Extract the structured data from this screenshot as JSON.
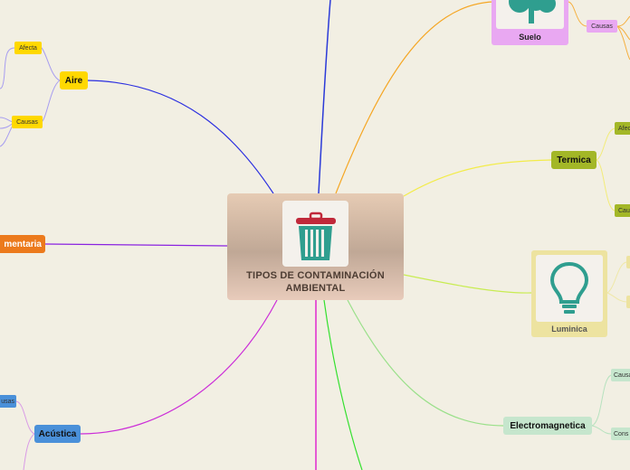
{
  "central": {
    "title": "TIPOS DE CONTAMINACIÓN AMBIENTAL",
    "icon": "trash-can-icon",
    "icon_color": "#2f9e8f",
    "lid_color": "#c0283a"
  },
  "topics": {
    "aire": {
      "label": "Aire",
      "color": "#ffd800",
      "children": [
        "Afecta",
        "Causas"
      ]
    },
    "alimentaria": {
      "label": "mentaria",
      "color": "#ec7a1c"
    },
    "acustica": {
      "label": "Acústica",
      "color": "#4a90d9",
      "children": [
        "usas"
      ]
    },
    "suelo": {
      "label": "Suelo",
      "color": "#e9a8f2",
      "icon": "tree-icon",
      "children": [
        "Causas"
      ]
    },
    "termica": {
      "label": "Termica",
      "color": "#a3b727",
      "children": [
        "Afec",
        "Cau"
      ]
    },
    "luminica": {
      "label": "Luminica",
      "color": "#ede3a0",
      "icon": "light-bulb-icon",
      "icon_color": "#2f9e8f"
    },
    "electromagnetica": {
      "label": "Electromagnetica",
      "color": "#c6e6cd",
      "children": [
        "Causa",
        "Cons"
      ]
    }
  }
}
